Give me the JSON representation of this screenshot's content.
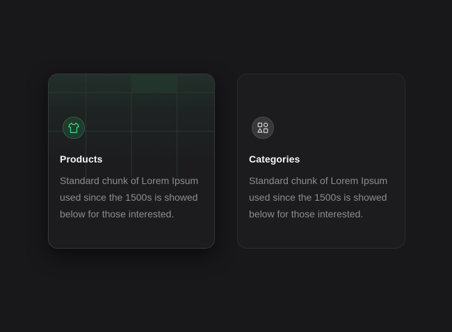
{
  "cards": [
    {
      "title": "Products",
      "description": "Standard chunk of Lorem Ipsum used since the 1500s is showed below for those interested.",
      "icon": "shirt-icon",
      "accent": "#4ade80"
    },
    {
      "title": "Categories",
      "description": "Standard chunk of Lorem Ipsum used since the 1500s is showed below for those interested.",
      "icon": "shapes-icon",
      "accent": "#d4d4d8"
    }
  ]
}
